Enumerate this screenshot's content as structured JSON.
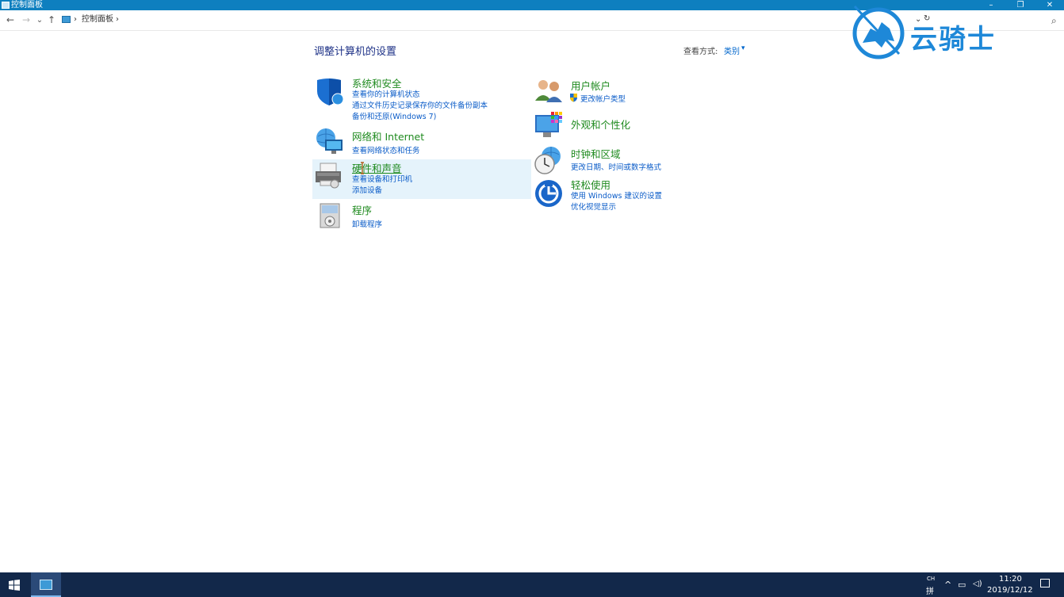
{
  "window": {
    "title": "控制面板",
    "minimize": "–",
    "restore": "❐",
    "close": "✕"
  },
  "address": {
    "back": "←",
    "forward": "→",
    "recent": "⌄",
    "up": "↑",
    "sep1": "›",
    "crumb": "控制面板",
    "sep2": "›",
    "dropdown": "⌄",
    "refresh": "↻",
    "search": "⌕"
  },
  "watermark": {
    "text": "云骑士"
  },
  "main": {
    "title": "调整计算机的设置",
    "view_label": "查看方式:",
    "view_value": "类别",
    "view_caret": "▾"
  },
  "left_categories": [
    {
      "title": "系统和安全",
      "links": [
        "查看你的计算机状态",
        "通过文件历史记录保存你的文件备份副本",
        "备份和还原(Windows 7)"
      ]
    },
    {
      "title": "网络和 Internet",
      "links": [
        "查看网络状态和任务"
      ]
    },
    {
      "title": "硬件和声音",
      "links": [
        "查看设备和打印机",
        "添加设备"
      ]
    },
    {
      "title": "程序",
      "links": [
        "卸载程序"
      ]
    }
  ],
  "right_categories": [
    {
      "title": "用户帐户",
      "links": [
        "更改帐户类型"
      ]
    },
    {
      "title": "外观和个性化",
      "links": []
    },
    {
      "title": "时钟和区域",
      "links": [
        "更改日期、时间或数字格式"
      ]
    },
    {
      "title": "轻松使用",
      "links": [
        "使用 Windows 建议的设置",
        "优化视觉显示"
      ]
    }
  ],
  "taskbar": {
    "ime_top": "CH",
    "ime_bottom": "拼",
    "chevron": "^",
    "network": "▭",
    "volume": "◁)",
    "time": "11:20",
    "date": "2019/12/12"
  },
  "colors": {
    "titlebar": "#0e7fbf",
    "category_title": "#1f8a1f",
    "link": "#0b5cc8",
    "taskbar": "#12284a",
    "hover": "#e5f3fb"
  }
}
